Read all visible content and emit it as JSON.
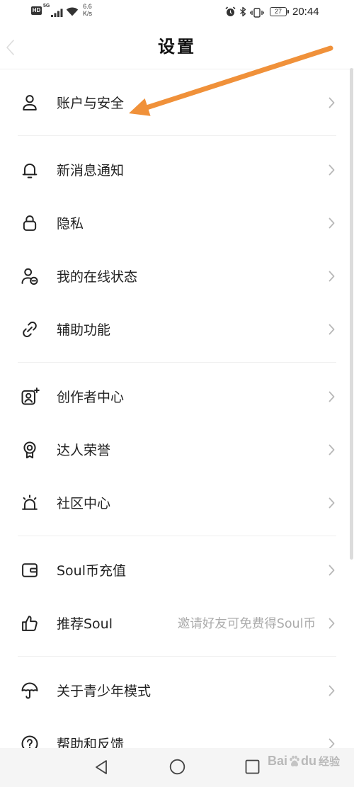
{
  "status_bar": {
    "hd": "HD",
    "network": "5G",
    "speed_value": "6.6",
    "speed_unit": "K/s",
    "battery": "27",
    "time": "20:44",
    "icons": [
      "signal-icon",
      "wifi-icon",
      "alarm-icon",
      "bluetooth-icon",
      "vibrate-icon",
      "battery-icon"
    ]
  },
  "header": {
    "title": "设置",
    "back_icon": "chevron-left-icon"
  },
  "sections": [
    {
      "items": [
        {
          "label": "账户与安全",
          "icon": "user-icon"
        }
      ]
    },
    {
      "items": [
        {
          "label": "新消息通知",
          "icon": "bell-icon"
        },
        {
          "label": "隐私",
          "icon": "lock-icon"
        },
        {
          "label": "我的在线状态",
          "icon": "online-status-icon"
        },
        {
          "label": "辅助功能",
          "icon": "link-icon"
        }
      ]
    },
    {
      "items": [
        {
          "label": "创作者中心",
          "icon": "creator-center-icon"
        },
        {
          "label": "达人荣誉",
          "icon": "medal-icon"
        },
        {
          "label": "社区中心",
          "icon": "siren-icon"
        }
      ]
    },
    {
      "items": [
        {
          "label": "Soul币充值",
          "icon": "wallet-icon"
        },
        {
          "label": "推荐Soul",
          "icon": "thumbs-up-icon",
          "hint": "邀请好友可免费得Soul币"
        }
      ]
    },
    {
      "items": [
        {
          "label": "关于青少年模式",
          "icon": "umbrella-icon"
        },
        {
          "label": "帮助和反馈",
          "icon": "help-icon"
        }
      ]
    }
  ],
  "nav_bar": {
    "icons": [
      "back-triangle-icon",
      "home-circle-icon",
      "recents-square-icon"
    ]
  },
  "watermark": {
    "brand_a": "Bai",
    "brand_b": "du",
    "product": "经验"
  },
  "colors": {
    "text": "#222222",
    "hint": "#ABABAB",
    "chevron": "#B8B8B8",
    "divider": "#EFEFEF",
    "annotation": "#F0913A",
    "nav_bg": "#F5F5F5"
  }
}
